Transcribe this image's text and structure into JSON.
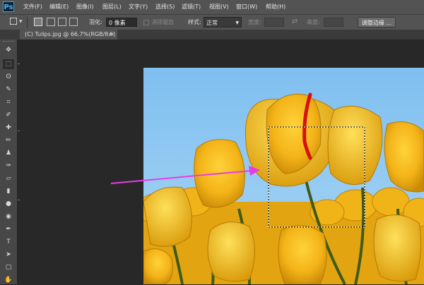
{
  "app": {
    "logo": "Ps"
  },
  "menu": [
    "文件(F)",
    "编辑(E)",
    "图像(I)",
    "图层(L)",
    "文字(Y)",
    "选择(S)",
    "滤镜(T)",
    "视图(V)",
    "窗口(W)",
    "帮助(H)"
  ],
  "options": {
    "feather_label": "羽化:",
    "feather_value": "0 像素",
    "antialias_label": "消除锯齿",
    "style_label": "样式:",
    "style_value": "正常",
    "width_label": "宽度:",
    "height_label": "高度:",
    "refine_edge_label": "调整边缘 ..."
  },
  "document": {
    "tab_label": "(C) Tulips.jpg @ 66.7%(RGB/8#)",
    "close_glyph": "×"
  },
  "toolbar": {
    "icons": [
      "move-icon",
      "marquee-icon",
      "lasso-icon",
      "quick-select-icon",
      "crop-icon",
      "eyedropper-icon",
      "healing-brush-icon",
      "brush-icon",
      "clone-stamp-icon",
      "history-brush-icon",
      "eraser-icon",
      "gradient-icon",
      "blur-icon",
      "dodge-icon",
      "pen-icon",
      "type-icon",
      "path-select-icon",
      "shape-icon",
      "hand-icon"
    ],
    "glyphs": [
      "✥",
      "⬚",
      "ʘ",
      "✎",
      "⌗",
      "✐",
      "✚",
      "✏",
      "♟",
      "✑",
      "▱",
      "▮",
      "●",
      "◉",
      "✒",
      "T",
      "➤",
      "▢",
      "✋"
    ]
  },
  "colors": {
    "accent": "#2fa3e6",
    "arrow": "#e63ce6",
    "stroke": "#d41010"
  }
}
